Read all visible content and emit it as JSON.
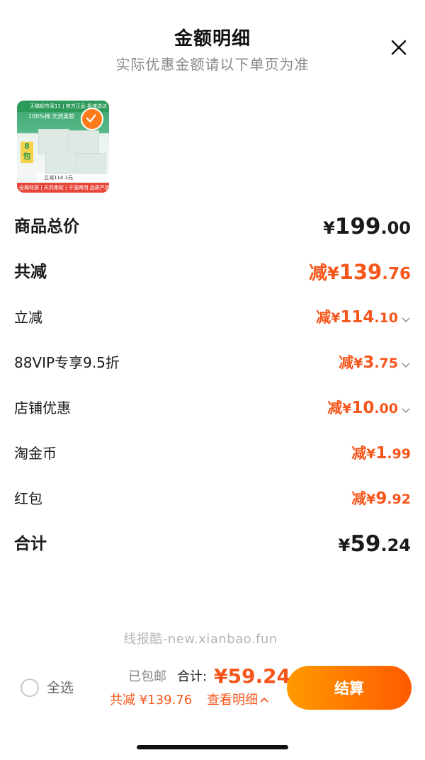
{
  "header": {
    "title": "金额明细",
    "subtitle": "实际优惠金额请以下单页为准"
  },
  "product_image": {
    "band1": "天猫超市双11 | 官方正品 极速送达",
    "band2": "100%棉 天然柔软",
    "price_tag": "立减114.1元",
    "bottom_strip": "全棉材质 | 天然柔软 | 干湿两用 品质严选",
    "badge": "8包"
  },
  "rows": [
    {
      "label": "商品总价",
      "prefix": "",
      "currency": "¥",
      "int": "199",
      "dec": ".00",
      "style": "total",
      "chevron": false
    },
    {
      "label": "共减",
      "prefix": "减",
      "currency": "¥",
      "int": "139",
      "dec": ".76",
      "style": "reduce_total",
      "chevron": false
    },
    {
      "label": "立减",
      "prefix": "减",
      "currency": "¥",
      "int": "114",
      "dec": ".10",
      "style": "item",
      "chevron": true
    },
    {
      "label": "88VIP专享9.5折",
      "prefix": "减",
      "currency": "¥",
      "int": "3",
      "dec": ".75",
      "style": "item",
      "chevron": true
    },
    {
      "label": "店铺优惠",
      "prefix": "减",
      "currency": "¥",
      "int": "10",
      "dec": ".00",
      "style": "item",
      "chevron": true
    },
    {
      "label": "淘金币",
      "prefix": "减",
      "currency": "¥",
      "int": "1",
      "dec": ".99",
      "style": "item",
      "chevron": false
    },
    {
      "label": "红包",
      "prefix": "减",
      "currency": "¥",
      "int": "9",
      "dec": ".92",
      "style": "item",
      "chevron": false
    },
    {
      "label": "合计",
      "prefix": "",
      "currency": "¥",
      "int": "59",
      "dec": ".24",
      "style": "total",
      "chevron": false
    }
  ],
  "watermark": "线报酷-new.xianbao.fun",
  "bottom": {
    "select_all": "全选",
    "shipping": "已包邮",
    "total_label": "合计:",
    "total_amount": "¥59.24",
    "reduce_text": "共减 ¥139.76",
    "detail_link": "查看明细",
    "checkout": "结算"
  },
  "colors": {
    "accent": "#f5561b",
    "checkout_gradient_start": "#ff9a00",
    "checkout_gradient_end": "#ff5a00"
  }
}
